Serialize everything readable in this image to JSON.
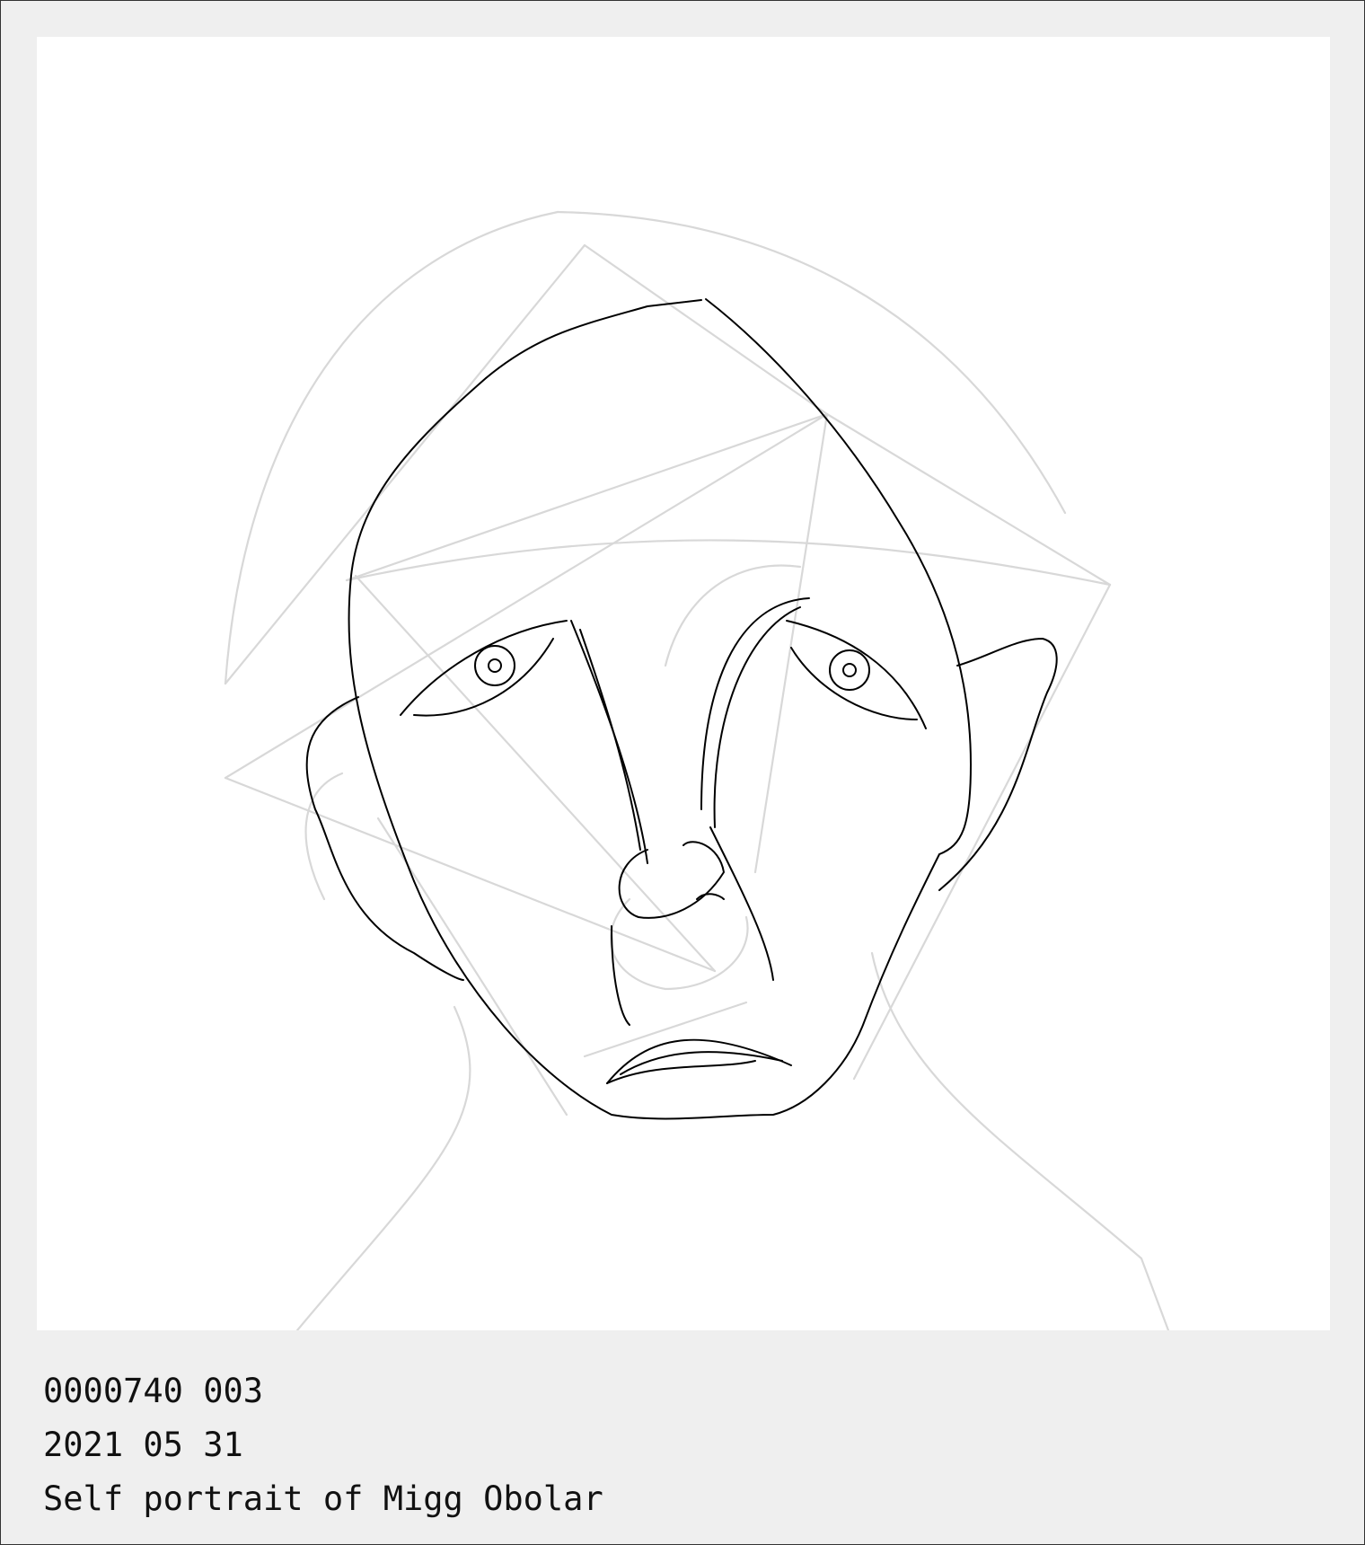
{
  "artwork": {
    "subject": "line-drawing-face-portrait",
    "ink_color": "#000000",
    "guide_color": "#d8d8d8",
    "frame_color": "#efefef"
  },
  "caption": {
    "id_line": "0000740 003",
    "date_line": "2021 05 31",
    "title_line": "Self portrait of Migg Obolar"
  }
}
